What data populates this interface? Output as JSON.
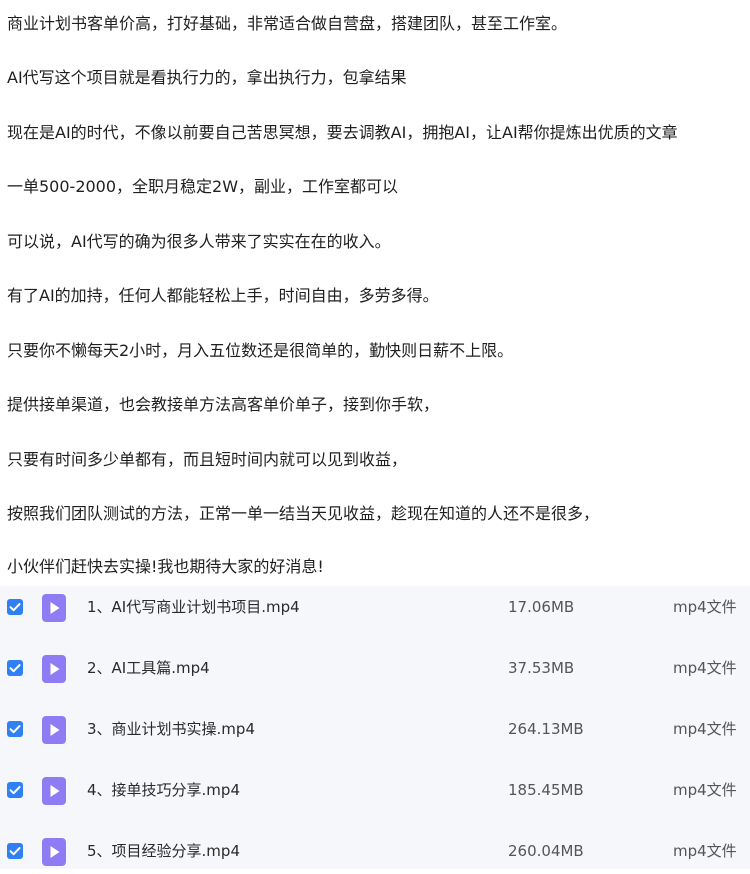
{
  "paragraphs": [
    "商业计划书客单价高，打好基础，非常适合做自营盘，搭建团队，甚至工作室。",
    "AI代写这个项目就是看执行力的，拿出执行力，包拿结果",
    "现在是AI的时代，不像以前要自己苦思冥想，要去调教AI，拥抱AI，让AI帮你提炼出优质的文章",
    "一单500-2000，全职月稳定2W，副业，工作室都可以",
    "可以说，AI代写的确为很多人带来了实实在在的收入。",
    "有了AI的加持，任何人都能轻松上手，时间自由，多劳多得。",
    "只要你不懒每天2小时，月入五位数还是很简单的，勤快则日薪不上限。",
    "提供接单渠道，也会教接单方法高客单价单子，接到你手软，",
    "只要有时间多少单都有，而且短时间内就可以见到收益，",
    "按照我们团队测试的方法，正常一单一结当天见收益，趁现在知道的人还不是很多，",
    "小伙伴们赶快去实操!我也期待大家的好消息!"
  ],
  "files": [
    {
      "name": "1、AI代写商业计划书项目.mp4",
      "size": "17.06MB",
      "type": "mp4文件"
    },
    {
      "name": "2、AI工具篇.mp4",
      "size": "37.53MB",
      "type": "mp4文件"
    },
    {
      "name": "3、商业计划书实操.mp4",
      "size": "264.13MB",
      "type": "mp4文件"
    },
    {
      "name": "4、接单技巧分享.mp4",
      "size": "185.45MB",
      "type": "mp4文件"
    },
    {
      "name": "5、项目经验分享.mp4",
      "size": "260.04MB",
      "type": "mp4文件"
    }
  ],
  "colors": {
    "checkbox": "#2f7ff5",
    "video_icon": "#8f7cf4",
    "list_background": "#f6f7fb"
  },
  "icons": {
    "checkbox": "checkbox-checked-icon",
    "file": "video-file-icon"
  }
}
